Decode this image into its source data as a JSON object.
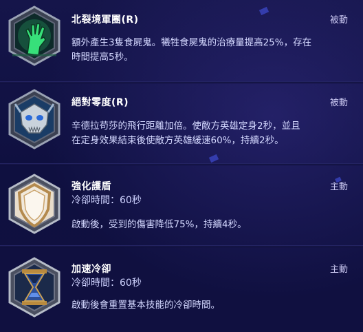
{
  "talents": [
    {
      "title": "北裂境軍團(R)",
      "type": "被動",
      "description_lines": [
        "額外產生3隻食屍鬼。犧牲食屍鬼的治療量提高25%，存在",
        "時間提高5秒。"
      ],
      "icon": "zombie-hand-icon"
    },
    {
      "title": "絕對零度(R)",
      "type": "被動",
      "description_lines": [
        "辛德拉苟莎的飛行距離加倍。使敵方英雄定身2秒，並且",
        "在定身效果結束後使敵方英雄緩速60%，持續2秒。"
      ],
      "icon": "frost-wyrm-skull-icon"
    },
    {
      "title": "強化護盾",
      "type": "主動",
      "cooldown": "冷卻時間：60秒",
      "description_lines": [
        "啟動後，受到的傷害降低75%，持續4秒。"
      ],
      "icon": "shield-icon"
    },
    {
      "title": "加速冷卻",
      "type": "主動",
      "cooldown": "冷卻時間：60秒",
      "description_lines": [
        "啟動後會重置基本技能的冷卻時間。"
      ],
      "icon": "hourglass-icon"
    }
  ],
  "colors": {
    "background": "#10103a",
    "title": "#ffffff",
    "description": "#d4d8ff",
    "type_label": "#c9c7f0",
    "frame": "#8e95a8"
  }
}
